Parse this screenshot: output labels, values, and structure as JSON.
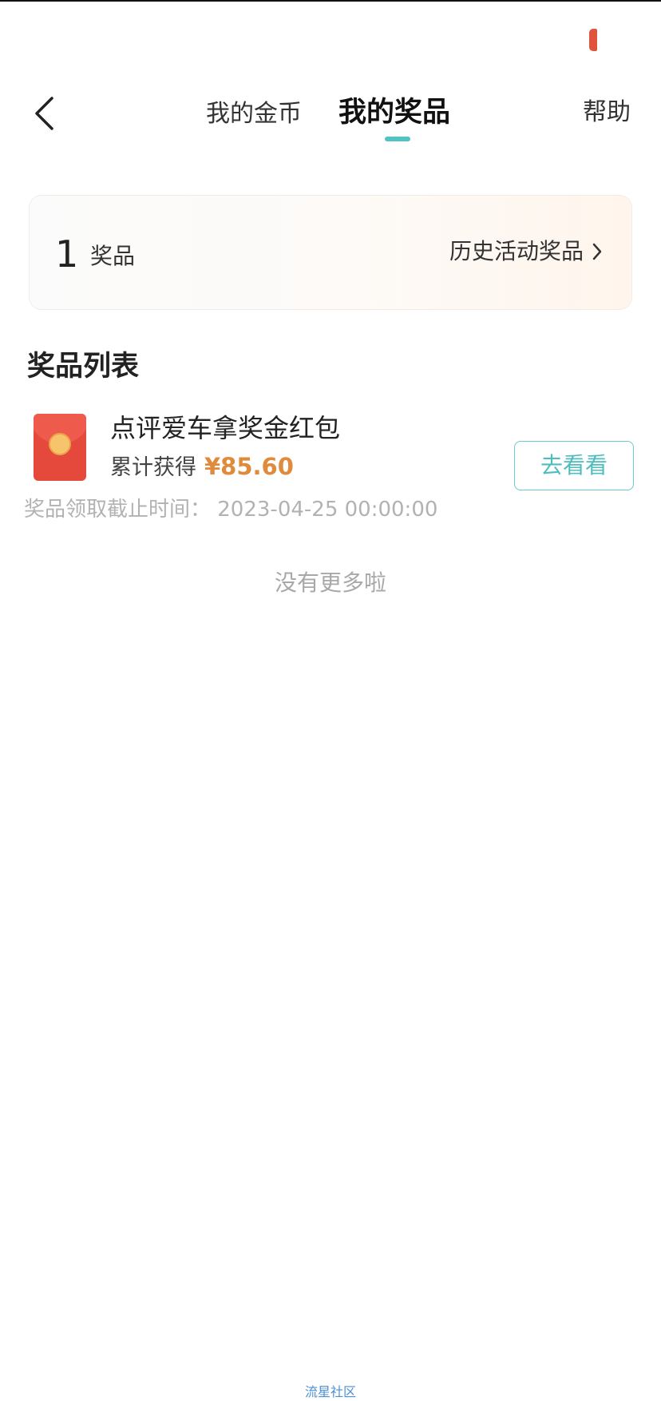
{
  "header": {
    "tabs": [
      {
        "label": "我的金币",
        "active": false
      },
      {
        "label": "我的奖品",
        "active": true
      }
    ],
    "help_label": "帮助",
    "accent_color": "#4fc4c4"
  },
  "summary": {
    "count": "1",
    "count_label": "奖品",
    "history_label": "历史活动奖品"
  },
  "section": {
    "title": "奖品列表"
  },
  "prizes": [
    {
      "name": "点评爱车拿奖金红包",
      "meta_label": "累计获得",
      "amount": "¥85.60",
      "action_label": "去看看",
      "deadline": "奖品领取截止时间：  2023-04-25 00:00:00",
      "icon": "red-packet-icon"
    }
  ],
  "footer": {
    "no_more": "没有更多啦",
    "watermark": "流星社区"
  }
}
